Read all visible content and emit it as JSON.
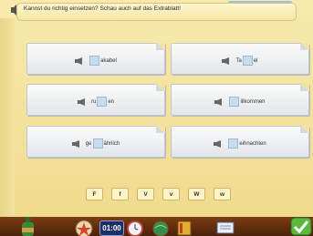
{
  "instruction": "Kannst du richtig einsetzen? Schau auch auf das Extrablatt!",
  "cards": [
    {
      "prefix": "",
      "suffix": "akabel"
    },
    {
      "prefix": "Ta",
      "suffix": "el"
    },
    {
      "prefix": "ru",
      "suffix": "en"
    },
    {
      "prefix": "",
      "suffix": "illkommen"
    },
    {
      "prefix": "ge",
      "suffix": "ährlich"
    },
    {
      "prefix": "",
      "suffix": "eihnachten"
    }
  ],
  "letters": [
    "F",
    "f",
    "V",
    "v",
    "W",
    "w"
  ],
  "toolbar": {
    "clock_display": "01:00"
  },
  "colors": {
    "background": "#f3e3a0",
    "gap_fill": "#c8dcef",
    "bottom_bar": "#5a2a0c",
    "check_button": "#5cb83a"
  },
  "icons": [
    "speaker-icon",
    "bottle-icon",
    "star-icon",
    "clock-icon",
    "globe-icon",
    "book-icon",
    "document-icon",
    "checkmark-icon"
  ]
}
